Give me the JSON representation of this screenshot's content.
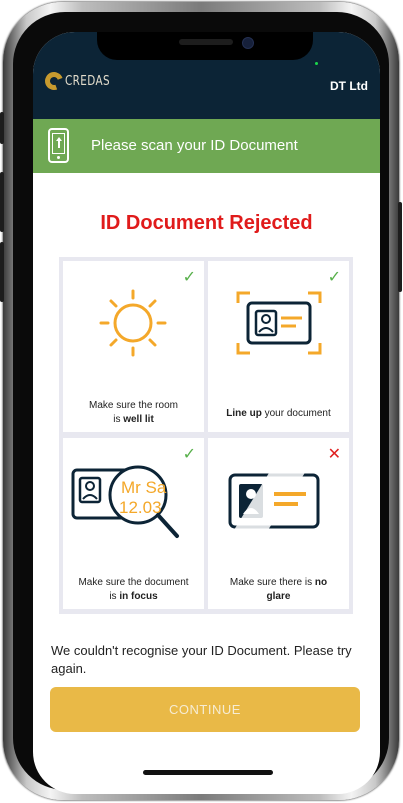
{
  "app": {
    "logo_text": "CREDAS",
    "company": "DT Ltd"
  },
  "banner": {
    "icon": "phone-upload-icon",
    "text": "Please scan your ID Document"
  },
  "status": {
    "title": "ID Document Rejected",
    "color": "#e01b1b"
  },
  "checks": [
    {
      "icon": "sun-icon",
      "caption_pre": "Make sure the room",
      "caption_mid": "is ",
      "caption_bold": "well lit",
      "caption_post": "",
      "result": "✓",
      "result_color": "#57b04a"
    },
    {
      "icon": "id-frame-icon",
      "caption_pre": "",
      "caption_mid": "",
      "caption_bold": "Line up",
      "caption_post": " your document",
      "result": "✓",
      "result_color": "#57b04a"
    },
    {
      "icon": "magnifier-icon",
      "caption_pre": "Make sure the document",
      "caption_mid": "is ",
      "caption_bold": "in focus",
      "caption_post": "",
      "result": "✓",
      "result_color": "#57b04a",
      "lens_text_1": "Mr Sa",
      "lens_text_2": "12.03"
    },
    {
      "icon": "glare-id-icon",
      "caption_pre": "Make sure there is ",
      "caption_mid": "",
      "caption_bold": "no",
      "caption_post": "",
      "caption_line2_bold": "glare",
      "result": "✕",
      "result_color": "#e02020"
    }
  ],
  "message": "We couldn't recognise your ID Document. Please try again.",
  "continue_label": "CONTINUE",
  "colors": {
    "header": "#0c2436",
    "banner": "#6fa853",
    "accent": "#e9b947",
    "icon_orange": "#f4a82a",
    "icon_navy": "#0c2436"
  }
}
